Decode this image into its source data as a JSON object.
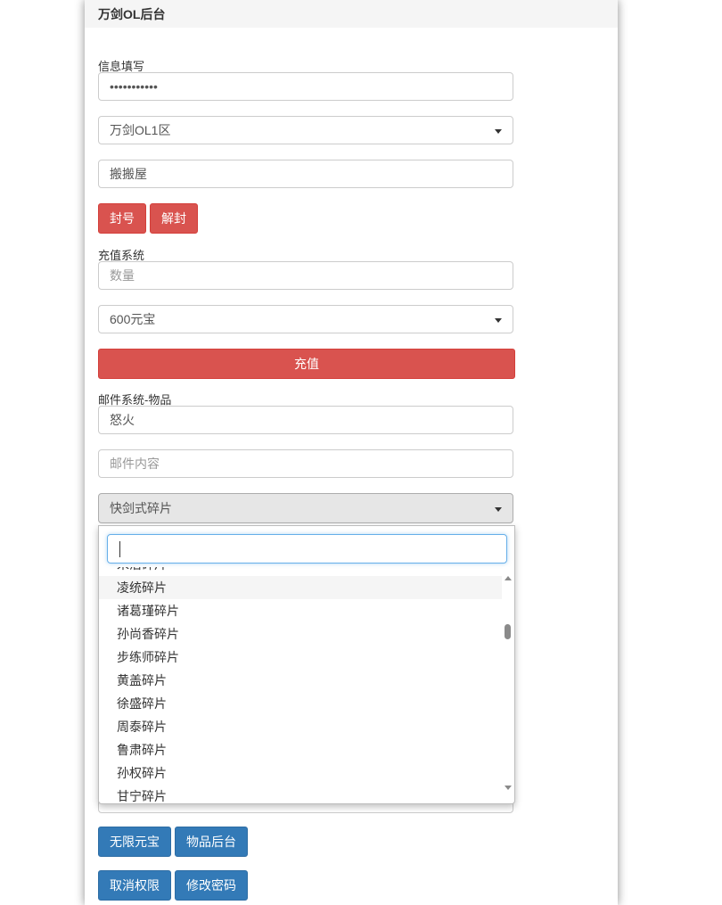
{
  "header": {
    "title": "万剑OL后台"
  },
  "info_section": {
    "label": "信息填写",
    "password_value": "•••••••••••",
    "server_select": "万剑OL1区",
    "role_value": "搬搬屋",
    "ban_label": "封号",
    "unban_label": "解封"
  },
  "recharge_section": {
    "label": "充值系统",
    "amount_placeholder": "数量",
    "package_select": "600元宝",
    "recharge_label": "充值"
  },
  "mail_section": {
    "label": "邮件系统-物品",
    "title_value": "怒火",
    "content_placeholder": "邮件内容",
    "item_select": "快剑式碎片"
  },
  "dropdown": {
    "search_value": "",
    "items": [
      "朱治碎片",
      "凌统碎片",
      "诸葛瑾碎片",
      "孙尚香碎片",
      "步练师碎片",
      "黄盖碎片",
      "徐盛碎片",
      "周泰碎片",
      "鲁肃碎片",
      "孙权碎片",
      "甘宁碎片"
    ],
    "highlighted_index": 1
  },
  "bottom_buttons": {
    "unlimited_label": "无限元宝",
    "item_backend_label": "物品后台",
    "revoke_label": "取消权限",
    "change_password_label": "修改密码"
  },
  "colors": {
    "danger": "#d9534f",
    "primary": "#337ab7",
    "focus": "#66afe9"
  }
}
